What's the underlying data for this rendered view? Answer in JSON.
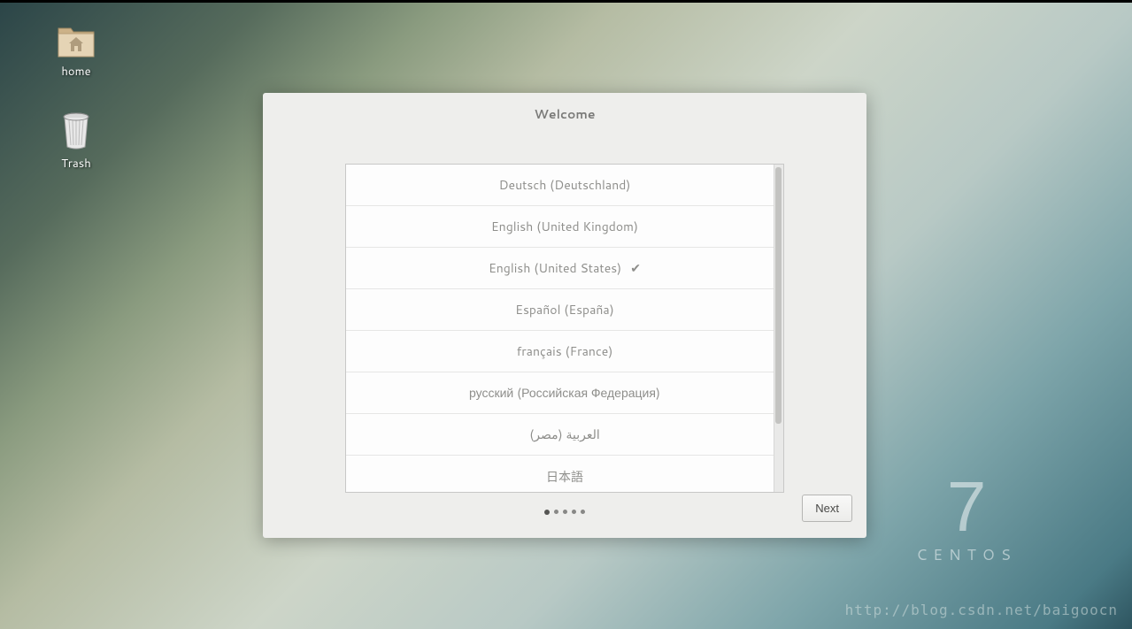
{
  "desktop": {
    "icons": [
      {
        "label": "home",
        "type": "folder"
      },
      {
        "label": "Trash",
        "type": "trash"
      }
    ]
  },
  "dialog": {
    "title": "Welcome",
    "languages": [
      {
        "label": "Deutsch (Deutschland)",
        "selected": false
      },
      {
        "label": "English (United Kingdom)",
        "selected": false
      },
      {
        "label": "English (United States)",
        "selected": true
      },
      {
        "label": "Español (España)",
        "selected": false
      },
      {
        "label": "français (France)",
        "selected": false
      },
      {
        "label": "русский (Российская Федерация)",
        "selected": false
      },
      {
        "label": "العربية (مصر)",
        "selected": false
      },
      {
        "label": "日本語",
        "selected": false
      }
    ],
    "next_button": "Next",
    "page_count": 5,
    "current_page": 0
  },
  "branding": {
    "version": "7",
    "name": "CENTOS"
  },
  "watermark": "http://blog.csdn.net/baigoocn"
}
